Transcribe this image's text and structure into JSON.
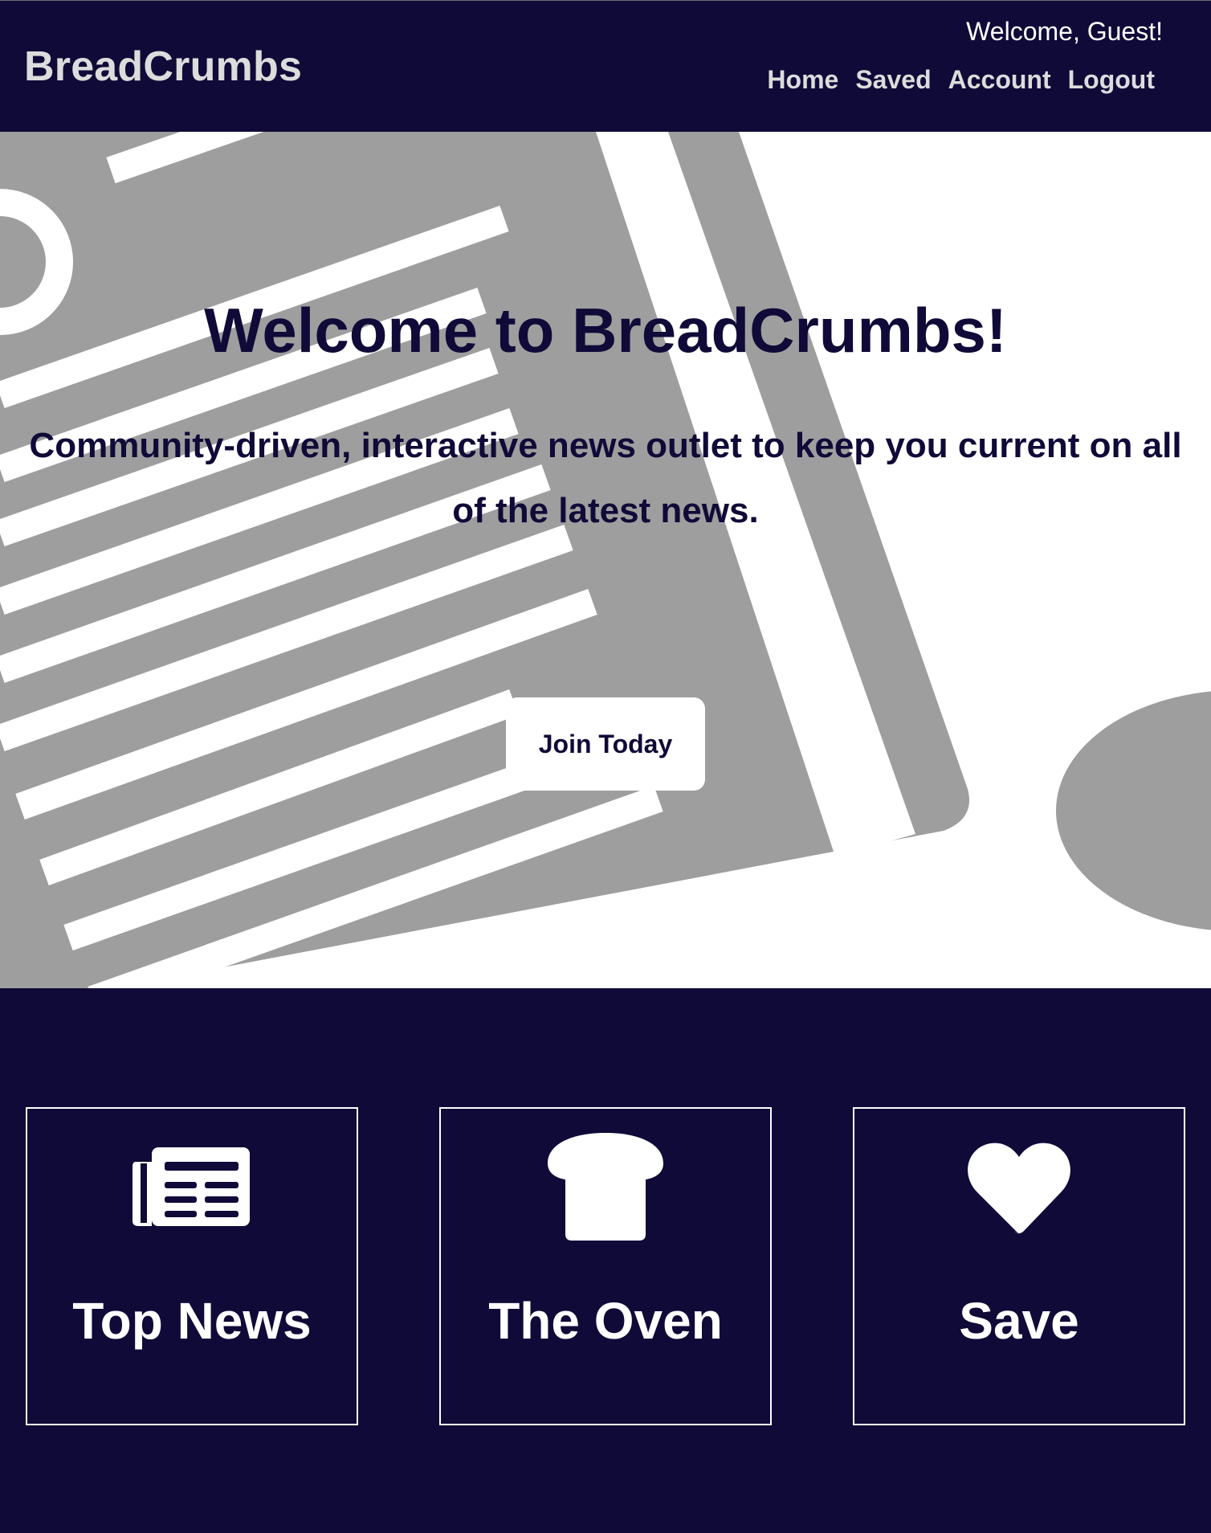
{
  "header": {
    "brand": "BreadCrumbs",
    "welcome": "Welcome, Guest!",
    "nav": [
      "Home",
      "Saved",
      "Account",
      "Logout"
    ]
  },
  "hero": {
    "title": "Welcome to BreadCrumbs!",
    "subtitle": "Community-driven, interactive news outlet to keep you current on all of the latest news.",
    "cta_label": "Join Today"
  },
  "features": [
    {
      "label": "Top News",
      "icon": "newspaper-icon"
    },
    {
      "label": "The Oven",
      "icon": "bread-icon"
    },
    {
      "label": "Save",
      "icon": "heart-icon"
    }
  ],
  "colors": {
    "primary": "#100a38",
    "hero_graphic": "#9e9e9e",
    "text_light": "#dcdcdc",
    "white": "#ffffff"
  }
}
